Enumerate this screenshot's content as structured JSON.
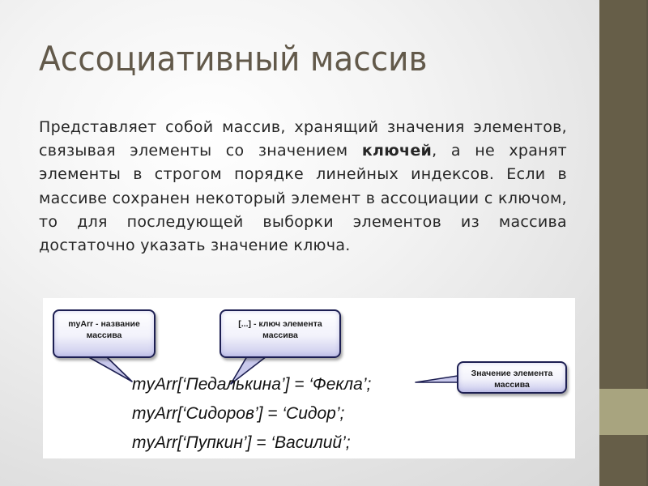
{
  "slide": {
    "title": "Ассоциативный массив",
    "body": {
      "part1": "Представляет собой массив,  хранящий значения элементов, связывая элементы со значением ",
      "bold": "ключей",
      "part2": ", а не хранят элементы в строгом порядке линейных индексов. Если в массиве сохранен некоторый элемент в ассоциации с ключом, то для последующей выборки элементов из массива достаточно указать значение ключа."
    },
    "diagram": {
      "callouts": [
        {
          "line1": "myArr - название",
          "line2": "массива"
        },
        {
          "line1": "[...] - ключ элемента",
          "line2": "массива"
        },
        {
          "line1": "Значение элемента",
          "line2": "массива"
        }
      ],
      "code_lines": [
        "myArr[‘Педалькина’] = ‘Фекла’;",
        "myArr[‘Сидоров’] = ‘Сидор’;",
        "myArr[‘Пупкин’] = ‘Василий’;"
      ]
    },
    "colors": {
      "sidebar": "#665e48",
      "sidebar_band": "#a8a47f",
      "title": "#62594a",
      "callout_border": "#1d1f52"
    }
  }
}
